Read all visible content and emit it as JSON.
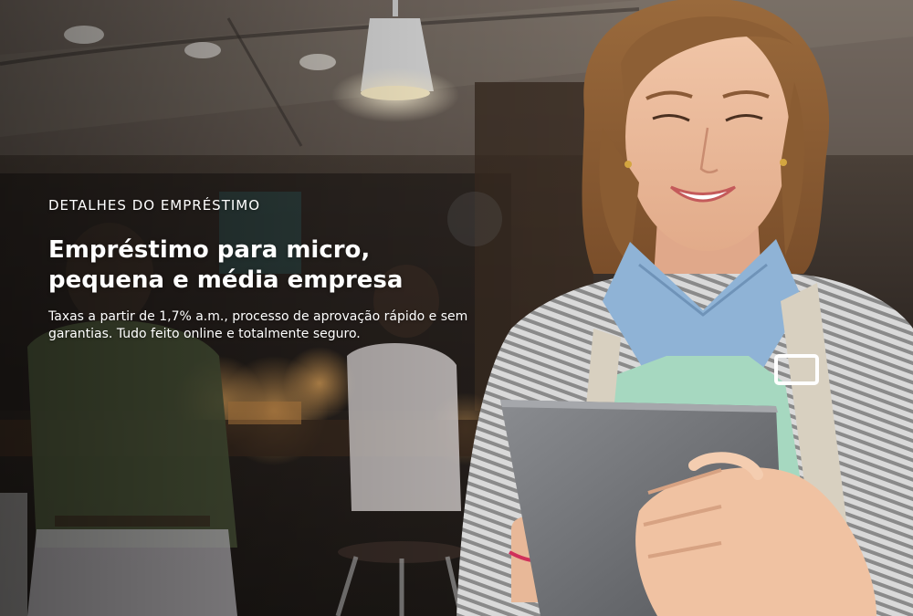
{
  "hero": {
    "eyebrow": "DETALHES DO EMPRÉSTIMO",
    "headline": "Empréstimo para micro, pequena e média empresa",
    "description": "Taxas a partir de 1,7% a.m., processo de aprovação rápido e sem garantias. Tudo feito online e totalmente seguro."
  },
  "image": {
    "subject": "woman-with-tablet-in-cafe-photo"
  },
  "colors": {
    "text": "#ffffff",
    "background_dark": "#2a2520",
    "tablet": "#6c6e72"
  }
}
